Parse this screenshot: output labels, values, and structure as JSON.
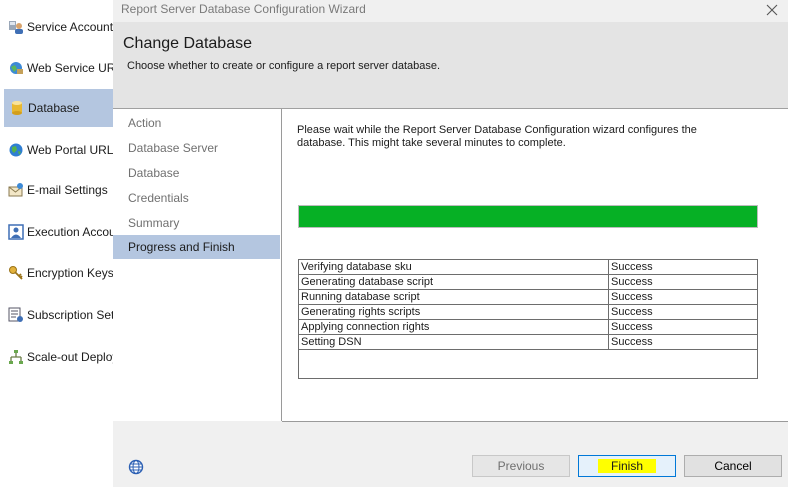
{
  "nav": {
    "items": [
      {
        "label": "Service Account"
      },
      {
        "label": "Web Service URL"
      },
      {
        "label": "Database"
      },
      {
        "label": "Web Portal URL"
      },
      {
        "label": "E-mail Settings"
      },
      {
        "label": "Execution Account"
      },
      {
        "label": "Encryption Keys"
      },
      {
        "label": "Subscription Settings"
      },
      {
        "label": "Scale-out Deployment"
      }
    ],
    "active_item": "Database"
  },
  "wizard": {
    "title": "Report Server Database Configuration Wizard",
    "header_title": "Change Database",
    "header_subtitle": "Choose whether to create or configure a report server database.",
    "steps": [
      {
        "label": "Action"
      },
      {
        "label": "Database Server"
      },
      {
        "label": "Database"
      },
      {
        "label": "Credentials"
      },
      {
        "label": "Summary"
      },
      {
        "label": "Progress and Finish"
      }
    ],
    "current_step": "Progress and Finish",
    "message": "Please wait while the Report Server Database Configuration wizard configures the database.  This might take several minutes to complete.",
    "progress_percent": 100,
    "progress_color": "#06b025",
    "status_rows": [
      {
        "task": "Verifying database sku",
        "status": "Success"
      },
      {
        "task": "Generating database script",
        "status": "Success"
      },
      {
        "task": "Running database script",
        "status": "Success"
      },
      {
        "task": "Generating rights scripts",
        "status": "Success"
      },
      {
        "task": "Applying connection rights",
        "status": "Success"
      },
      {
        "task": "Setting DSN",
        "status": "Success"
      }
    ],
    "buttons": {
      "previous": "Previous",
      "finish": "Finish",
      "cancel": "Cancel"
    }
  },
  "colors": {
    "selection": "#b4c6e0",
    "highlight": "#ffff00",
    "accent": "#0078d7"
  }
}
